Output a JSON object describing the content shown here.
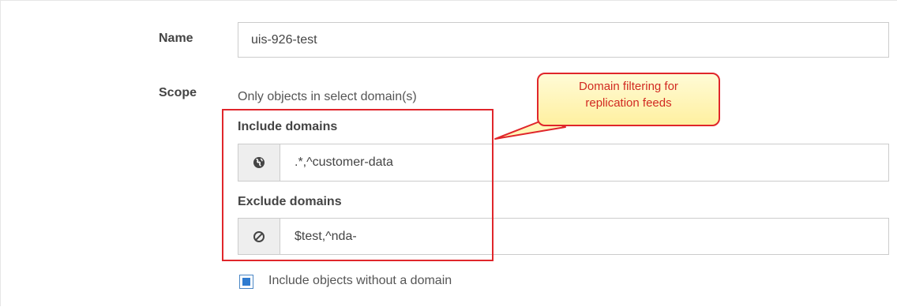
{
  "form": {
    "name_label": "Name",
    "name_value": "uis-926-test",
    "scope_label": "Scope",
    "scope_description": "Only objects in select domain(s)",
    "include_domains": {
      "label": "Include domains",
      "icon": "globe-icon",
      "value": ".*,^customer-data"
    },
    "exclude_domains": {
      "label": "Exclude domains",
      "icon": "ban-icon",
      "value": "$test,^nda-"
    },
    "include_without_domain": {
      "label": "Include objects without a domain",
      "checked": true
    }
  },
  "annotation": {
    "callout_text_line1": "Domain filtering for",
    "callout_text_line2": "replication feeds",
    "color": "#e0262b"
  },
  "colors": {
    "accent": "#2f7bd0",
    "highlight": "#e0262b",
    "callout_text": "#d12a22"
  }
}
